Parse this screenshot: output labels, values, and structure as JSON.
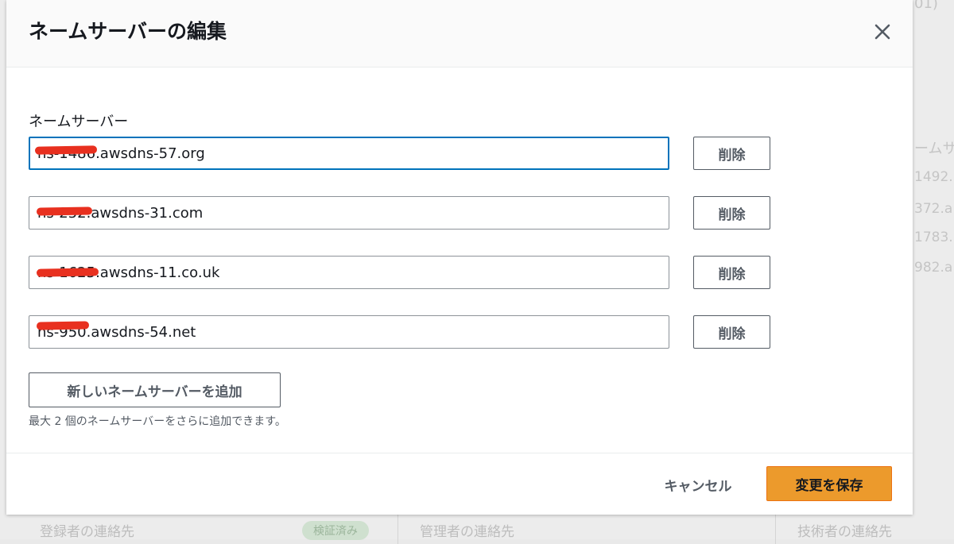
{
  "background": {
    "title_fragment": "01)",
    "column_header_fragment": "ームサ",
    "rows": [
      "1492.",
      "372.a",
      "1783.",
      "982.a"
    ],
    "footer": {
      "registrant_label": "登録者の連絡先",
      "verified_badge": "検証済み",
      "admin_label": "管理者の連絡先",
      "tech_label": "技術者の連絡先"
    }
  },
  "modal": {
    "title": "ネームサーバーの編集",
    "close_icon": "close-icon",
    "field_label": "ネームサーバー",
    "nameservers": [
      {
        "value": "ns-1486.awsdns-57.org"
      },
      {
        "value": "ns-252.awsdns-31.com"
      },
      {
        "value": "ns-1625.awsdns-11.co.uk"
      },
      {
        "value": "ns-950.awsdns-54.net"
      }
    ],
    "remove_label": "削除",
    "add_label": "新しいネームサーバーを追加",
    "hint": "最大 2 個のネームサーバーをさらに追加できます。",
    "cancel_label": "キャンセル",
    "save_label": "変更を保存"
  },
  "colors": {
    "primary_button": "#ec9a2c",
    "focus_border": "#0073bb",
    "redaction": "#e8301f"
  }
}
